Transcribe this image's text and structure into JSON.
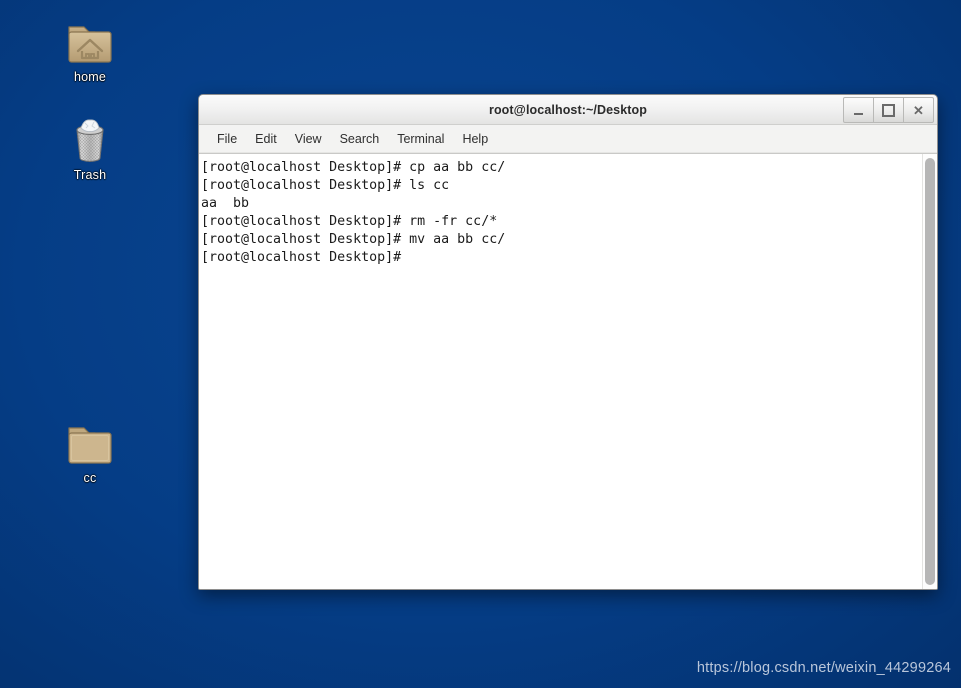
{
  "desktop": {
    "background_color": "#043d85",
    "icons": [
      {
        "id": "home",
        "label": "home",
        "icon": "home-folder-icon"
      },
      {
        "id": "trash",
        "label": "Trash",
        "icon": "trash-can-icon"
      },
      {
        "id": "cc",
        "label": "cc",
        "icon": "folder-icon"
      }
    ],
    "watermark": "https://blog.csdn.net/weixin_44299264"
  },
  "window": {
    "title": "root@localhost:~/Desktop",
    "controls": {
      "minimize": "minimize-button",
      "maximize": "maximize-button",
      "close": "close-button"
    },
    "menu": [
      {
        "label": "File"
      },
      {
        "label": "Edit"
      },
      {
        "label": "View"
      },
      {
        "label": "Search"
      },
      {
        "label": "Terminal"
      },
      {
        "label": "Help"
      }
    ],
    "terminal": {
      "prompt": "[root@localhost Desktop]#",
      "lines": [
        "[root@localhost Desktop]# cp aa bb cc/",
        "[root@localhost Desktop]# ls cc",
        "aa  bb",
        "[root@localhost Desktop]# rm -fr cc/*",
        "[root@localhost Desktop]# mv aa bb cc/",
        "[root@localhost Desktop]#"
      ],
      "text": "[root@localhost Desktop]# cp aa bb cc/\n[root@localhost Desktop]# ls cc\naa  bb\n[root@localhost Desktop]# rm -fr cc/*\n[root@localhost Desktop]# mv aa bb cc/\n[root@localhost Desktop]#",
      "foreground_color": "#1b1b1b",
      "background_color": "#ffffff"
    }
  }
}
